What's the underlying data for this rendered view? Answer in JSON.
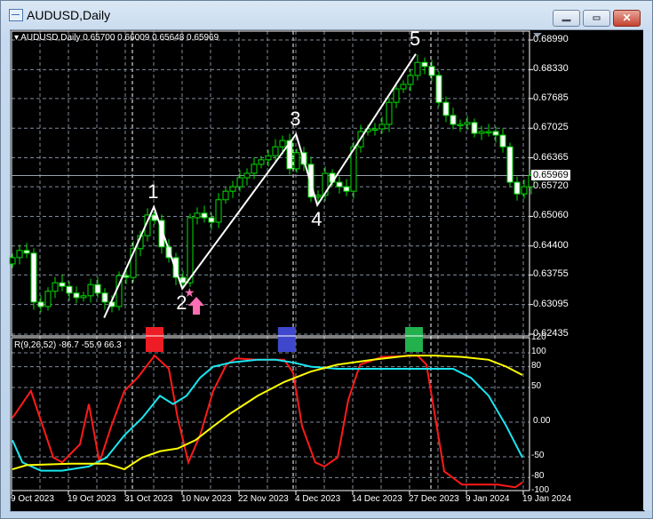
{
  "window": {
    "title": "AUDUSD,Daily",
    "min_icon": "minimize-icon",
    "max_icon": "maximize-icon",
    "close_icon": "close-icon"
  },
  "chart_header": "AUDUSD,Daily  0.65700 0.66009 0.65648 0.65969",
  "indicator_header": "R(9,26,52) -86.7 -55.9 66.3",
  "colors": {
    "bull_border": "#00e000",
    "bear_fill": "#ffffff",
    "grid": "#7f8a99",
    "red": "#ff1a1a",
    "cyan": "#1ae6f0",
    "yellow": "#ffff00",
    "marker_red": "#ee1c25",
    "marker_blue": "#3f48cc",
    "marker_green": "#22b14c",
    "pink": "#ff6eb4"
  },
  "chart_data": [
    {
      "type": "candlestick",
      "title": "AUDUSD,Daily",
      "current_price": "0.65969",
      "y_ticks": [
        "0.68990",
        "0.68330",
        "0.67685",
        "0.67025",
        "0.66365",
        "0.65720",
        "0.65060",
        "0.64400",
        "0.63755",
        "0.63095",
        "0.62435"
      ],
      "ylim": [
        0.62435,
        0.6899
      ],
      "x_ticks": [
        "9 Oct 2023",
        "19 Oct 2023",
        "31 Oct 2023",
        "10 Nov 2023",
        "22 Nov 2023",
        "4 Dec 2023",
        "14 Dec 2023",
        "27 Dec 2023",
        "9 Jan 2024",
        "19 Jan 2024"
      ],
      "first_open": 0.64,
      "closes": [
        0.6414,
        0.643,
        0.6424,
        0.6315,
        0.6305,
        0.6339,
        0.6358,
        0.635,
        0.6335,
        0.6325,
        0.6329,
        0.6354,
        0.6335,
        0.6315,
        0.6305,
        0.6374,
        0.637,
        0.6434,
        0.6463,
        0.6509,
        0.6497,
        0.6438,
        0.6414,
        0.637,
        0.6358,
        0.6503,
        0.6513,
        0.6503,
        0.6493,
        0.6543,
        0.6562,
        0.6572,
        0.6592,
        0.6602,
        0.6622,
        0.6632,
        0.6641,
        0.6661,
        0.6675,
        0.6612,
        0.6648,
        0.6622,
        0.6549,
        0.6553,
        0.6602,
        0.6582,
        0.6572,
        0.6562,
        0.6661,
        0.6695,
        0.6701,
        0.6701,
        0.6711,
        0.676,
        0.679,
        0.68,
        0.682,
        0.6849,
        0.684,
        0.682,
        0.676,
        0.6731,
        0.6711,
        0.6711,
        0.6715,
        0.6691,
        0.6695,
        0.6695,
        0.6687,
        0.6661,
        0.6582,
        0.6556,
        0.6572,
        0.6597
      ],
      "zigzag": [
        {
          "bar": 12.9,
          "price": 0.628,
          "label": ""
        },
        {
          "bar": 19.9,
          "price": 0.6527,
          "label": "1"
        },
        {
          "bar": 23.9,
          "price": 0.6345,
          "label": "2"
        },
        {
          "bar": 39.9,
          "price": 0.6689,
          "label": "3"
        },
        {
          "bar": 42.9,
          "price": 0.6531,
          "label": "4"
        },
        {
          "bar": 56.75,
          "price": 0.6868,
          "label": "5"
        }
      ]
    },
    {
      "type": "line",
      "title": "R(9,26,52)",
      "ylim": [
        -100,
        120
      ],
      "y_ticks": [
        "120",
        "100",
        "80",
        "50",
        "0.00",
        "-50",
        "-80",
        "-100"
      ],
      "y_tick_values": [
        120,
        100,
        80,
        50,
        0,
        -50,
        -80,
        -100
      ],
      "series": [
        {
          "name": "R9",
          "color": "#ff1a1a",
          "last": -86.7,
          "points": [
            [
              0,
              6
            ],
            [
              2.6,
              45
            ],
            [
              5.75,
              -51
            ],
            [
              7,
              -58
            ],
            [
              9.5,
              -32
            ],
            [
              10.75,
              26
            ],
            [
              12.25,
              -58
            ],
            [
              13.9,
              -6
            ],
            [
              15.75,
              45
            ],
            [
              17.6,
              64
            ],
            [
              20,
              96
            ],
            [
              22,
              77
            ],
            [
              23.25,
              6
            ],
            [
              24.75,
              -58
            ],
            [
              26.4,
              -19
            ],
            [
              28.25,
              45
            ],
            [
              30.1,
              83
            ],
            [
              31.4,
              92
            ],
            [
              34.5,
              90
            ],
            [
              38.25,
              90
            ],
            [
              39.5,
              71
            ],
            [
              40.75,
              -6
            ],
            [
              42.6,
              -58
            ],
            [
              43.9,
              -64
            ],
            [
              45.75,
              -51
            ],
            [
              47.25,
              32
            ],
            [
              48.9,
              83
            ],
            [
              52,
              94
            ],
            [
              57,
              96
            ],
            [
              58.25,
              83
            ],
            [
              59.5,
              6
            ],
            [
              60.75,
              -71
            ],
            [
              63.25,
              -90
            ],
            [
              68.25,
              -90
            ],
            [
              70.75,
              -94
            ],
            [
              71.75,
              -87
            ]
          ]
        },
        {
          "name": "R26",
          "color": "#1ae6f0",
          "last": -55.9,
          "points": [
            [
              0,
              -26
            ],
            [
              1.4,
              -58
            ],
            [
              4,
              -70
            ],
            [
              7,
              -70
            ],
            [
              10.75,
              -64
            ],
            [
              13.25,
              -51
            ],
            [
              15.75,
              -19
            ],
            [
              18.25,
              6
            ],
            [
              20.75,
              38
            ],
            [
              22.6,
              26
            ],
            [
              24.5,
              38
            ],
            [
              26.4,
              64
            ],
            [
              28.25,
              80
            ],
            [
              30.75,
              86
            ],
            [
              34.5,
              90
            ],
            [
              37,
              90
            ],
            [
              39.5,
              86
            ],
            [
              42,
              80
            ],
            [
              45.75,
              77
            ],
            [
              50.75,
              77
            ],
            [
              58.25,
              77
            ],
            [
              62,
              77
            ],
            [
              64.5,
              64
            ],
            [
              67,
              38
            ],
            [
              69.5,
              -6
            ],
            [
              71.75,
              -51
            ]
          ]
        },
        {
          "name": "R52",
          "color": "#ffff00",
          "last": 66.3,
          "points": [
            [
              0,
              -68
            ],
            [
              2,
              -62
            ],
            [
              8.25,
              -60
            ],
            [
              13.25,
              -60
            ],
            [
              15.75,
              -68
            ],
            [
              18.25,
              -51
            ],
            [
              20.75,
              -42
            ],
            [
              23.25,
              -38
            ],
            [
              25.75,
              -26
            ],
            [
              28.25,
              -6
            ],
            [
              30.75,
              13
            ],
            [
              34.5,
              38
            ],
            [
              38.25,
              58
            ],
            [
              42,
              73
            ],
            [
              45.75,
              83
            ],
            [
              50.75,
              90
            ],
            [
              55.75,
              96
            ],
            [
              59.5,
              96
            ],
            [
              63.25,
              94
            ],
            [
              67,
              90
            ],
            [
              69.5,
              80
            ],
            [
              71.75,
              68
            ]
          ]
        }
      ],
      "markers": [
        {
          "bar": 20,
          "color": "marker_red"
        },
        {
          "bar": 38.6,
          "color": "marker_blue"
        },
        {
          "bar": 56.5,
          "color": "marker_green"
        }
      ]
    }
  ]
}
